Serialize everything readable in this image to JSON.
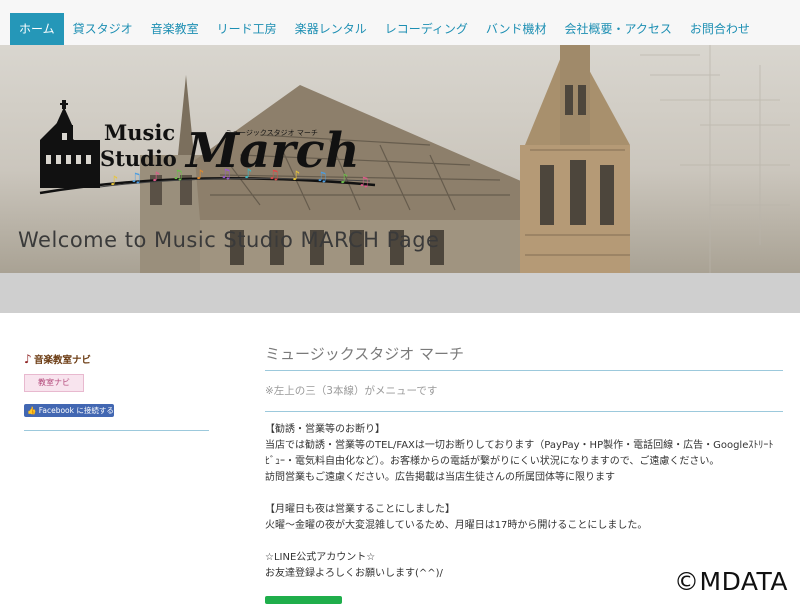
{
  "nav": {
    "items": [
      "ホーム",
      "貸スタジオ",
      "音楽教室",
      "リード工房",
      "楽器レンタル",
      "レコーディング",
      "バンド機材",
      "会社概要・アクセス",
      "お問合わせ"
    ]
  },
  "hero": {
    "logo_line1": "Music",
    "logo_line2": "Studio",
    "logo_main": "March",
    "logo_kana": "ミュージックスタジオ マーチ",
    "welcome": "Welcome to Music Studio MARCH Page"
  },
  "sidebar": {
    "banner1": "音楽教室ナビ",
    "banner2": "教室ナビ",
    "facebook": "Facebook に接続する"
  },
  "main": {
    "title": "ミュージックスタジオ マーチ",
    "menu_hint": "※左上の三（3本線）がメニューです",
    "lines": [
      "【勧誘・営業等のお断り】",
      "当店では勧誘・営業等のTEL/FAXは一切お断りしております（PayPay・HP製作・電話回線・広告・Googleｽﾄﾘｰﾄﾋﾞｭｰ・電気料自由化など）。お客様からの電話が繋がりにくい状況になりますので、ご遠慮ください。",
      "訪問営業もご遠慮ください。広告掲載は当店生徒さんの所属団体等に限ります",
      "",
      "【月曜日も夜は営業することにしました】",
      "火曜～金曜の夜が大変混雑しているため、月曜日は17時から開けることにしました。",
      "",
      "☆LINE公式アカウント☆",
      "お友達登録よろしくお願いします(^^)/"
    ]
  },
  "watermark": "©MDATA",
  "colors": {
    "nav_active": "#2597b8",
    "nav_text": "#1d8fb3",
    "rule": "#9cc9dc",
    "line_button": "#1fae4b"
  }
}
